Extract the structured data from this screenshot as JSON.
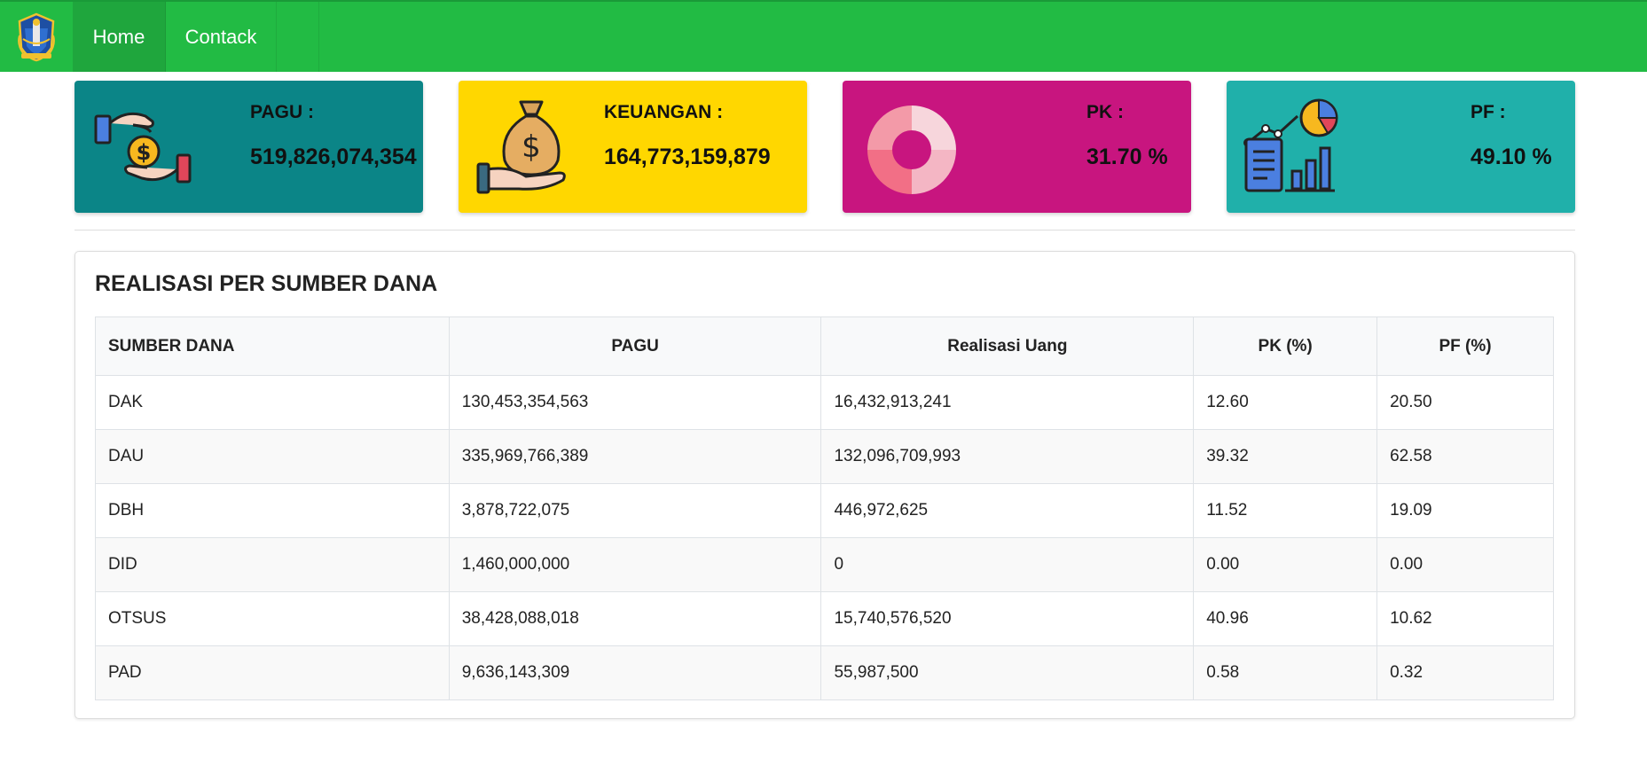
{
  "nav": {
    "items": [
      {
        "label": "Home"
      },
      {
        "label": "Contack"
      }
    ]
  },
  "cards": [
    {
      "label": "PAGU :",
      "value": "519,826,074,354",
      "color": "#0b8587",
      "icon": "money-exchange-icon"
    },
    {
      "label": "KEUANGAN :",
      "value": "164,773,159,879",
      "color": "#ffd700",
      "icon": "money-bag-hand-icon"
    },
    {
      "label": "PK :",
      "value": "31.70 %",
      "color": "#c8157f",
      "icon": "donut-chart-icon"
    },
    {
      "label": "PF :",
      "value": "49.10 %",
      "color": "#20b0aa",
      "icon": "report-chart-icon"
    }
  ],
  "panel": {
    "title": "REALISASI PER SUMBER DANA",
    "columns": [
      "SUMBER DANA",
      "PAGU",
      "Realisasi Uang",
      "PK (%)",
      "PF (%)"
    ],
    "rows": [
      [
        "DAK",
        "130,453,354,563",
        "16,432,913,241",
        "12.60",
        "20.50"
      ],
      [
        "DAU",
        "335,969,766,389",
        "132,096,709,993",
        "39.32",
        "62.58"
      ],
      [
        "DBH",
        "3,878,722,075",
        "446,972,625",
        "11.52",
        "19.09"
      ],
      [
        "DID",
        "1,460,000,000",
        "0",
        "0.00",
        "0.00"
      ],
      [
        "OTSUS",
        "38,428,088,018",
        "15,740,576,520",
        "40.96",
        "10.62"
      ],
      [
        "PAD",
        "9,636,143,309",
        "55,987,500",
        "0.58",
        "0.32"
      ]
    ]
  }
}
